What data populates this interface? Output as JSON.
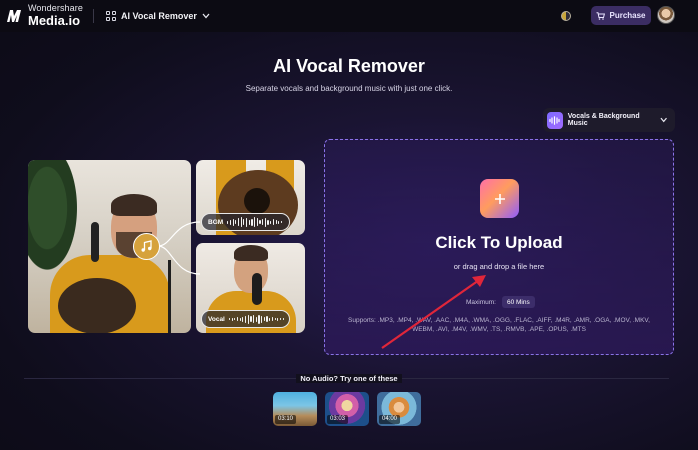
{
  "header": {
    "brand_small": "Wondershare",
    "brand_big": "Media.io",
    "tool_name": "AI Vocal Remover",
    "purchase_label": "Purchase"
  },
  "hero": {
    "title": "AI Vocal Remover",
    "subtitle": "Separate vocals and background music with just one click."
  },
  "mode": {
    "selected": "Vocals & Background Music"
  },
  "illustration": {
    "bgm_label": "BGM",
    "vocal_label": "Vocal"
  },
  "upload": {
    "title": "Click To Upload",
    "subtitle": "or drag and drop a file here",
    "max_label": "Maximum:",
    "max_value": "60 Mins",
    "supports_line1": "Supports: .MP3, .MP4, .WAV, .AAC, .M4A, .WMA, .OGG, .FLAC, .AIFF, .M4R, .AMR, .OGA, .MOV, .MKV,",
    "supports_line2": "WEBM, .AVI, .M4V, .WMV, .TS, .RMVB, .APE, .OPUS, .MTS"
  },
  "samples": {
    "label": "No Audio? Try one of these",
    "items": [
      {
        "duration": "03:10"
      },
      {
        "duration": "03:03"
      },
      {
        "duration": "04:00"
      }
    ]
  },
  "colors": {
    "accent": "#8a73e8",
    "purchase_bg": "#3b2d63",
    "arrow": "#e0263a",
    "photo_yellow": "#d89a1c"
  },
  "icons": [
    "logo-icon",
    "apps-icon",
    "chevron-down-icon",
    "theme-toggle-icon",
    "cart-icon",
    "waveform-icon",
    "music-note-icon",
    "plus-icon"
  ]
}
